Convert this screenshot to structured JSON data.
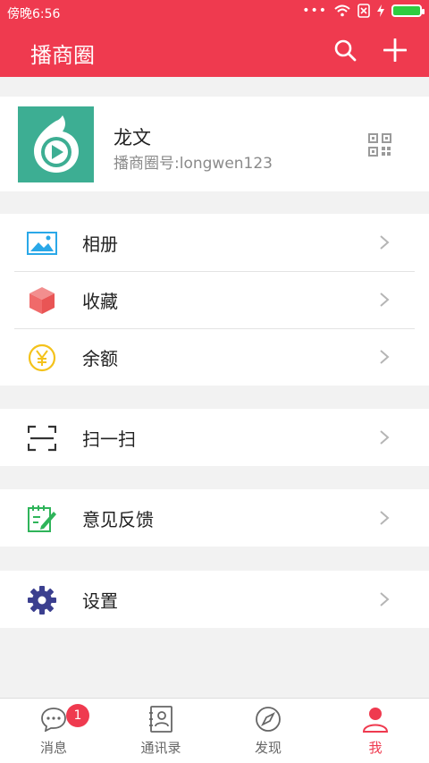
{
  "status_bar": {
    "time": "傍晚6:56",
    "dots": "•••"
  },
  "header": {
    "title": "播商圈"
  },
  "profile": {
    "name": "龙文",
    "id_text": "播商圈号:longwen123"
  },
  "menu": {
    "album": "相册",
    "favorites": "收藏",
    "balance": "余额",
    "scan": "扫一扫",
    "feedback": "意见反馈",
    "settings": "设置"
  },
  "bottom_nav": {
    "messages": {
      "label": "消息",
      "badge": "1"
    },
    "contacts": {
      "label": "通讯录"
    },
    "discover": {
      "label": "发现"
    },
    "me": {
      "label": "我"
    }
  },
  "colors": {
    "brand_red": "#ef3a4f",
    "avatar_green": "#3dae93",
    "album_blue": "#2aa8e8",
    "fav_red": "#f06a6a",
    "balance_yellow": "#f4c21b",
    "feedback_green": "#2fb45a",
    "settings_navy": "#3b3f8f"
  }
}
